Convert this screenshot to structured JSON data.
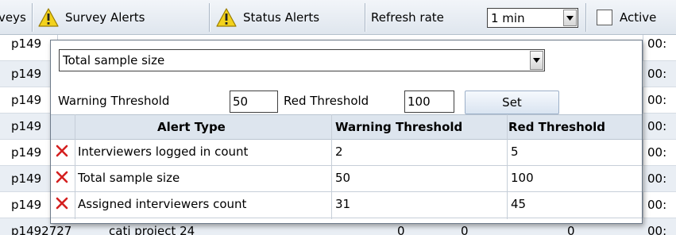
{
  "toolbar": {
    "surveys_label": "veys",
    "survey_alerts_label": "Survey Alerts",
    "status_alerts_label": "Status Alerts",
    "refresh_rate_label": "Refresh rate",
    "refresh_rate_value": "1 min",
    "active_label": "Active"
  },
  "background_rows": [
    {
      "id": "p149",
      "time": "00:"
    },
    {
      "id": "p149",
      "time": "00:"
    },
    {
      "id": "p149",
      "time": "00:"
    },
    {
      "id": "p149",
      "time": "00:"
    },
    {
      "id": "p149",
      "time": "00:"
    },
    {
      "id": "p149",
      "time": "00:"
    },
    {
      "id": "p149",
      "time": "00:"
    },
    {
      "id": "p1492727",
      "name": "cati project 24",
      "n1": "0",
      "n2": "0",
      "n3": "0",
      "time": "00:"
    }
  ],
  "popup": {
    "alert_select_value": "Total sample size",
    "warning_label": "Warning Threshold",
    "warning_value": "50",
    "red_label": "Red Threshold",
    "red_value": "100",
    "set_label": "Set",
    "table": {
      "headers": {
        "alert_type": "Alert Type",
        "warning": "Warning Threshold",
        "red": "Red Threshold"
      },
      "rows": [
        {
          "type": "Interviewers logged in count",
          "warning": "2",
          "red": "5"
        },
        {
          "type": "Total sample size",
          "warning": "50",
          "red": "100"
        },
        {
          "type": "Assigned interviewers count",
          "warning": "31",
          "red": "45"
        }
      ]
    }
  },
  "colors": {
    "warning_icon": "#f3d21c",
    "delete_icon": "#d42020",
    "row_alt": "#e9eef4"
  },
  "icons": [
    "warning-icon",
    "chevron-down-icon",
    "delete-icon"
  ]
}
